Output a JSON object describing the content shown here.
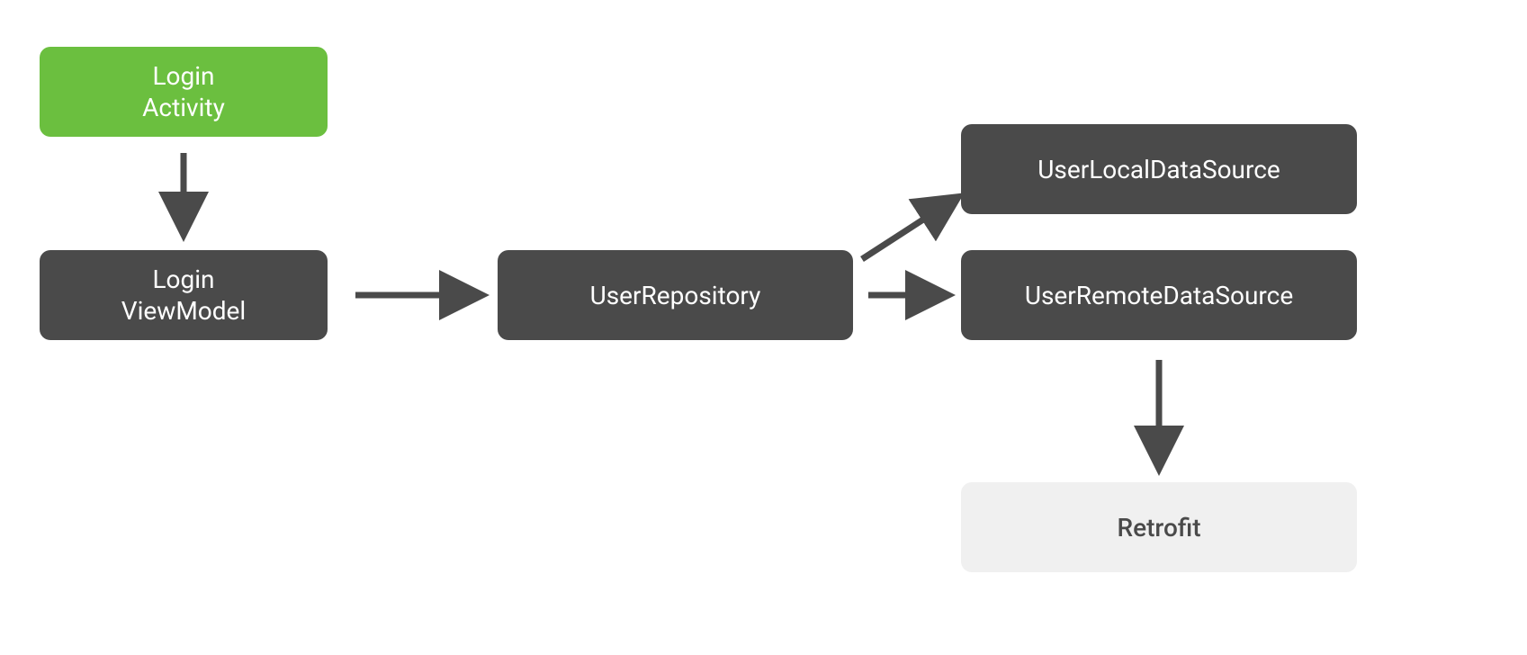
{
  "nodes": {
    "login_activity": {
      "line1": "Login",
      "line2": "Activity"
    },
    "login_viewmodel": {
      "line1": "Login",
      "line2": "ViewModel"
    },
    "user_repository": {
      "label": "UserRepository"
    },
    "user_local_ds": {
      "label": "UserLocalDataSource"
    },
    "user_remote_ds": {
      "label": "UserRemoteDataSource"
    },
    "retrofit": {
      "label": "Retrofit"
    }
  },
  "colors": {
    "green": "#6bbf3f",
    "dark": "#4a4a4a",
    "light": "#f0f0f0",
    "arrow": "#4a4a4a"
  },
  "edges": [
    {
      "from": "login_activity",
      "to": "login_viewmodel"
    },
    {
      "from": "login_viewmodel",
      "to": "user_repository"
    },
    {
      "from": "user_repository",
      "to": "user_local_ds"
    },
    {
      "from": "user_repository",
      "to": "user_remote_ds"
    },
    {
      "from": "user_remote_ds",
      "to": "retrofit"
    }
  ]
}
